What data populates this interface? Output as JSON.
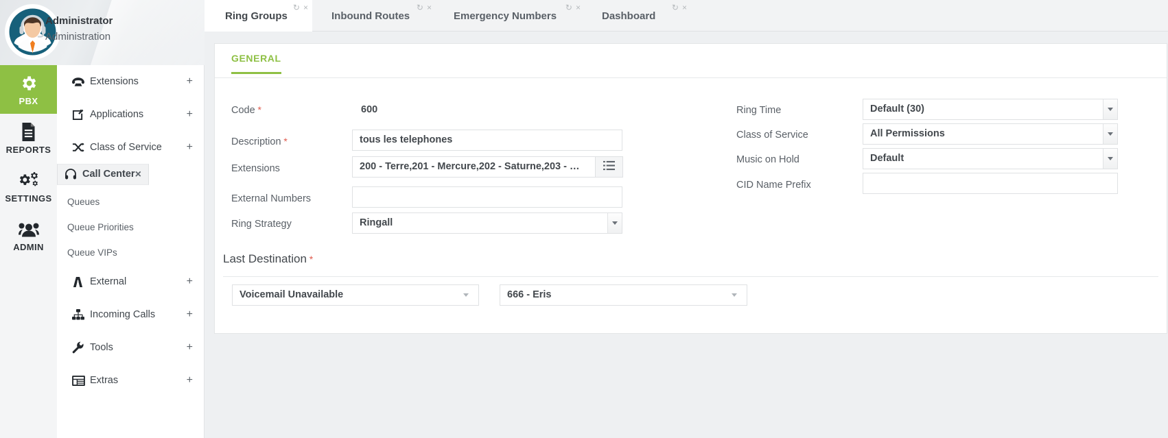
{
  "user": {
    "name": "Administrator",
    "role": "Administration",
    "avatar_icon": "user-avatar-headset"
  },
  "rail": [
    {
      "label": "PBX",
      "icon": "gear-icon",
      "active": true
    },
    {
      "label": "REPORTS",
      "icon": "document-icon",
      "active": false
    },
    {
      "label": "SETTINGS",
      "icon": "gears-icon",
      "active": false
    },
    {
      "label": "ADMIN",
      "icon": "users-icon",
      "active": false
    }
  ],
  "menu": [
    {
      "label": "Extensions",
      "icon": "phone-icon",
      "action": "+",
      "selected": false
    },
    {
      "label": "Applications",
      "icon": "edit-square-icon",
      "action": "+",
      "selected": false
    },
    {
      "label": "Class of Service",
      "icon": "shuffle-icon",
      "action": "+",
      "selected": false
    },
    {
      "label": "Call Center",
      "icon": "headset-icon",
      "action": "×",
      "selected": true
    }
  ],
  "submenu": [
    "Ring Groups",
    "Queues",
    "Queue Priorities",
    "Queue VIPs"
  ],
  "menu2": [
    {
      "label": "External",
      "icon": "highway-icon",
      "action": "+"
    },
    {
      "label": "Incoming Calls",
      "icon": "sitemap-icon",
      "action": "+"
    },
    {
      "label": "Tools",
      "icon": "wrench-icon",
      "action": "+"
    },
    {
      "label": "Extras",
      "icon": "window-icon",
      "action": "+"
    }
  ],
  "tabs": [
    {
      "label": "Ring Groups",
      "active": true
    },
    {
      "label": "Inbound Routes",
      "active": false
    },
    {
      "label": "Emergency Numbers",
      "active": false
    },
    {
      "label": "Dashboard",
      "active": false
    }
  ],
  "tab_tools": {
    "refresh": "↻",
    "close": "×"
  },
  "card": {
    "tab_label": "GENERAL",
    "left_fields": {
      "code_label": "Code",
      "code_value": "600",
      "description_label": "Description",
      "description_value": "tous les telephones",
      "description_placeholder": "",
      "extensions_label": "Extensions",
      "extensions_value": "200 - Terre,201 - Mercure,202 - Saturne,203 - …",
      "extensions_button_icon": "list-icon",
      "external_numbers_label": "External Numbers",
      "external_numbers_value": "",
      "external_numbers_placeholder": "",
      "ring_strategy_label": "Ring Strategy",
      "ring_strategy_value": "Ringall"
    },
    "right_fields": {
      "ring_time_label": "Ring Time",
      "ring_time_value": "Default (30)",
      "class_of_service_label": "Class of Service",
      "class_of_service_value": "All Permissions",
      "music_on_hold_label": "Music on Hold",
      "music_on_hold_value": "Default",
      "cid_name_prefix_label": "CID Name Prefix",
      "cid_name_prefix_value": "",
      "cid_name_prefix_placeholder": ""
    },
    "last_destination": {
      "title": "Last Destination",
      "type_value": "Voicemail Unavailable",
      "target_value": "666 - Eris"
    }
  },
  "colors": {
    "accent_green": "#8ec044",
    "required_red": "#e05b4e",
    "page_bg": "#eef0f2",
    "text": "#43484d"
  }
}
